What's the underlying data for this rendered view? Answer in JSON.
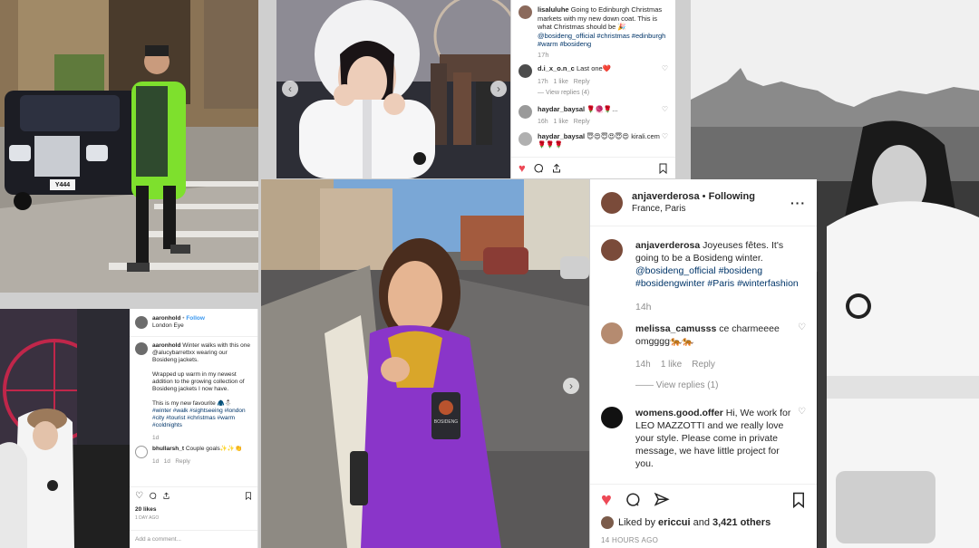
{
  "post_a": {
    "username": "aaronhold",
    "follow_label": "Follow",
    "location": "London Eye",
    "caption_user": "aaronhold",
    "caption_text": "Winter walks with this one @alucybarrettxx wearing our Bosideng jackets.",
    "caption_p2": "Wrapped up warm in my newest addition to the growing collection of Bosideng jackets I now have.",
    "caption_p3": "This is my new favourite 🧥⛄",
    "caption_tags": "#winter #walk #sightseeing #london #city #tourist #christmas #warm #coldnights",
    "caption_age": "1d",
    "comment_user": "bhullarsh_t",
    "comment_text": "Couple goals✨✨👏",
    "comment_age": "1d",
    "comment_likes": "1d",
    "comment_reply": "Reply",
    "likes": "20 likes",
    "date": "1 DAY AGO",
    "add_comment": "Add a comment..."
  },
  "post_b": {
    "caption_user": "lisaluluhe",
    "caption_text": "Going to Edinburgh Christmas markets with my new down coat. This is what Christmas should be 🎉",
    "caption_tags": "@bosideng_official #christmas #edinburgh #warm #bosideng",
    "caption_age": "17h",
    "comments": [
      {
        "user": "d.i_x_o.n_c",
        "text": "Last one❤️",
        "age": "17h",
        "likes": "1 like",
        "reply": "Reply",
        "view_replies": "View replies (4)"
      },
      {
        "user": "haydar_baysal",
        "text": "🌹🧶🌹...",
        "age": "16h",
        "likes": "1 like",
        "reply": "Reply",
        "view_replies": ""
      },
      {
        "user": "haydar_baysal",
        "text": "😇😍😇😍😇😍 kirali.cem 🌹🌹🌹",
        "age": "",
        "likes": "",
        "reply": "",
        "view_replies": ""
      }
    ]
  },
  "post_c": {
    "username": "anjaverderosa",
    "follow_state": "Following",
    "location": "France, Paris",
    "caption_user": "anjaverderosa",
    "caption_text": "Joyeuses fêtes. It's going to be a Bosideng winter.",
    "caption_tags": "@bosideng_official #bosideng #bosidengwinter #Paris #winterfashion",
    "caption_age": "14h",
    "comments": [
      {
        "user": "melissa_camusss",
        "text": "ce charmeeee omgggg🐅🐅",
        "age": "14h",
        "likes": "1 like",
        "reply": "Reply",
        "view_replies": "View replies (1)"
      },
      {
        "user": "womens.good.offer",
        "text": "Hi, We work for LEO MAZZOTTI and we really love your style. Please come in private message, we have little project for you.",
        "age": "",
        "likes": "",
        "reply": "",
        "view_replies": ""
      }
    ],
    "liked_by_prefix": "Liked by",
    "liked_by_user": "ericcui",
    "liked_by_and": "and",
    "liked_by_others": "3,421 others",
    "date": "14 HOURS AGO"
  },
  "photo_text": {
    "plate": "Y444",
    "brand_patch": "BOSIDENG"
  },
  "icons": {
    "more": "more-options-icon",
    "heart_liked": "heart-filled-icon",
    "comment": "comment-icon",
    "share": "share-icon",
    "save": "bookmark-icon"
  },
  "colors": {
    "like_red": "#ed4956",
    "link_blue": "#003569",
    "follow_blue": "#3897f0"
  }
}
